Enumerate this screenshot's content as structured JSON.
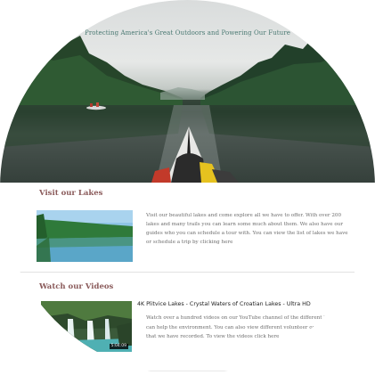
{
  "hero": {
    "tagline": "Protecting America's Great Outdoors and Powering Our Future"
  },
  "lakes": {
    "title": "Visit our Lakes",
    "description": "Visit our beautiful lakes and come explore all we have to offer. With over 200 lakes and many trails you can learn some much about them. We also have our guides who you can schedule a tour with. You can view the list of lakes we have or schedule a trip by clicking here"
  },
  "videos": {
    "title": "Watch our Videos",
    "video_title": "4K Plitvice Lakes - Crystal Waters of Croatian Lakes - Ultra HD",
    "duration": "5:04:09",
    "description": "Watch over a hundred videos on our YouTube channel of the different lakes you can help the environment. You can also view different volunteer opportunities that we have recorded. To view the videos click here"
  }
}
